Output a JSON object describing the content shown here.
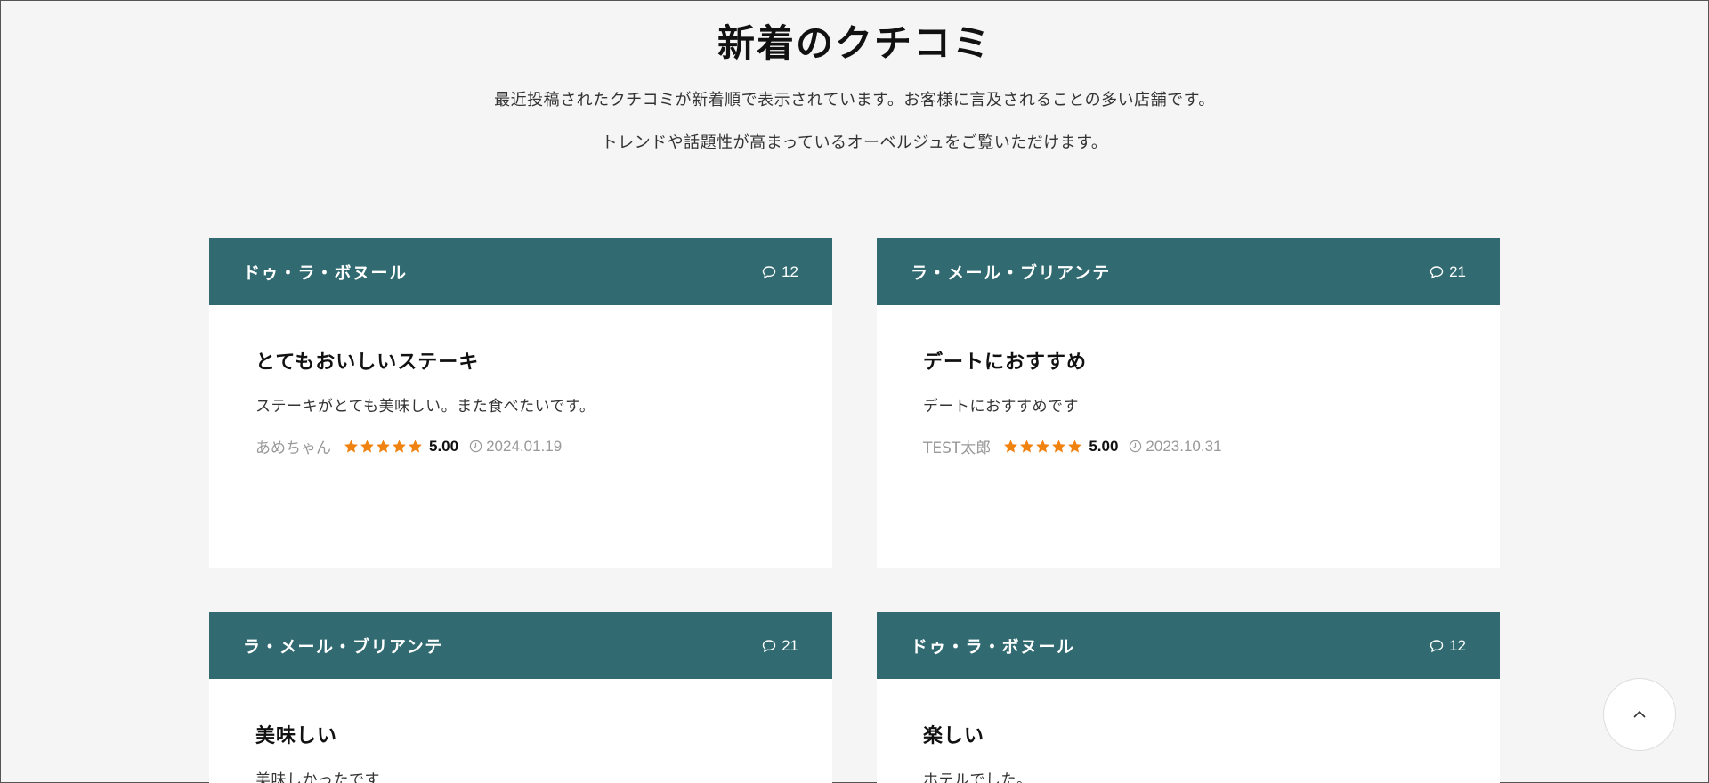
{
  "section": {
    "title": "新着のクチコミ",
    "intro_line1": "最近投稿されたクチコミが新着順で表示されています。お客様に言及されることの多い店舗です。",
    "intro_line2": "トレンドや話題性が高まっているオーベルジュをご覧いただけます。"
  },
  "reviews": [
    {
      "shop": "ドゥ・ラ・ボヌール",
      "comments": "12",
      "title": "とてもおいしいステーキ",
      "text": "ステーキがとても美味しい。また食べたいです。",
      "author": "あめちゃん",
      "rating": "5.00",
      "date": "2024.01.19"
    },
    {
      "shop": "ラ・メール・ブリアンテ",
      "comments": "21",
      "title": "デートにおすすめ",
      "text": "デートにおすすめです",
      "author": "TEST太郎",
      "rating": "5.00",
      "date": "2023.10.31"
    },
    {
      "shop": "ラ・メール・ブリアンテ",
      "comments": "21",
      "title": "美味しい",
      "text": "美味しかったです"
    },
    {
      "shop": "ドゥ・ラ・ボヌール",
      "comments": "12",
      "title": "楽しい",
      "text": "ホテルでした。"
    }
  ],
  "colors": {
    "header_bg": "#316b71",
    "star": "#f0820f",
    "page_bg": "#f5f5f5"
  },
  "icons": {
    "comment": "speech-bubble-icon",
    "star": "star-icon",
    "date": "clock-icon",
    "back_to_top": "chevron-up-icon"
  }
}
